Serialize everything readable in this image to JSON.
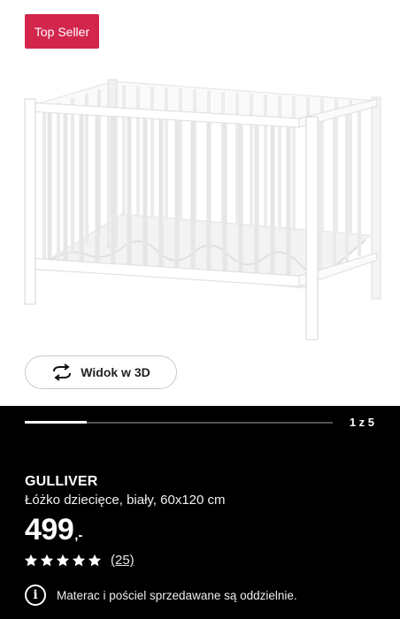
{
  "badge": {
    "label": "Top Seller",
    "color": "#d3264c"
  },
  "view3d": {
    "label": "Widok w 3D",
    "icon": "rotate-3d-icon"
  },
  "gallery": {
    "counter": "1 z 5",
    "current": 1,
    "total": 5
  },
  "product": {
    "name": "GULLIVER",
    "description": "Łóżko dziecięce, biały, 60x120 cm",
    "price": "499",
    "price_suffix": ",-",
    "rating": 5,
    "reviews": "(25)"
  },
  "notice": {
    "icon": "info-icon",
    "text": "Materac i pościel sprzedawane są oddzielnie."
  },
  "colors": {
    "background": "#000000",
    "accent": "#d3264c"
  }
}
